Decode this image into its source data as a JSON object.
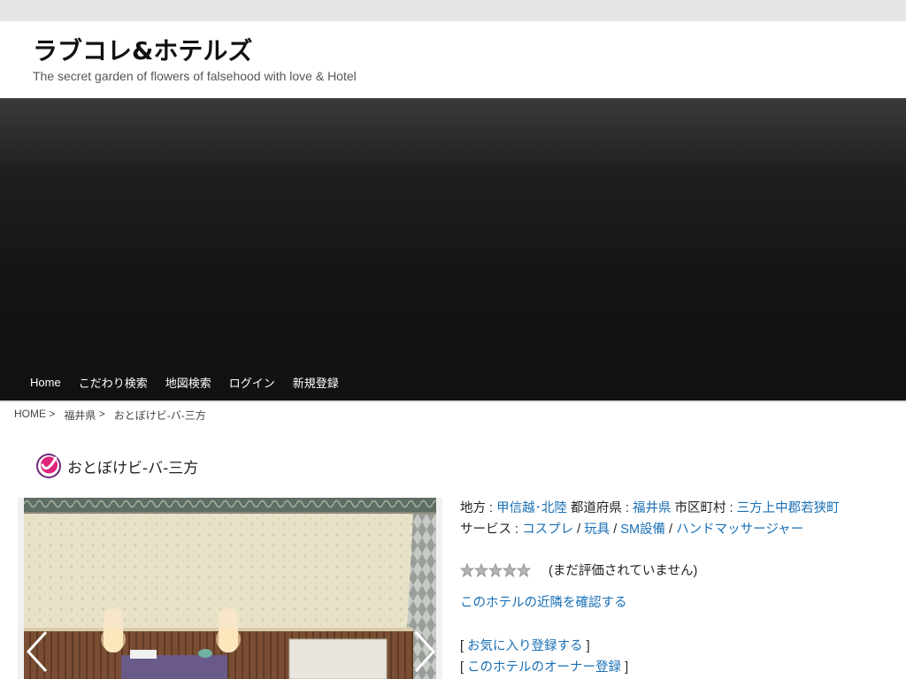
{
  "site": {
    "title": "ラブコレ&ホテルズ",
    "tagline": "The secret garden of flowers of falsehood with love & Hotel"
  },
  "nav": {
    "items": [
      "Home",
      "こだわり検索",
      "地図検索",
      "ログイン",
      "新規登録"
    ]
  },
  "breadcrumb": {
    "home": "HOME",
    "pref": "福井県",
    "current": "おとぼけビ-バ-三方",
    "sep": " > "
  },
  "hotel": {
    "title": "おとぼけビ-バ-三方",
    "region_label": "地方 : ",
    "region": "甲信越･北陸",
    "pref_label": "都道府県 : ",
    "pref": "福井県",
    "city_label": "市区町村 : ",
    "city": "三方上中郡若狭町",
    "service_label": "サービス : ",
    "services": [
      "コスプレ",
      "玩具",
      "SM設備",
      "ハンドマッサージャー"
    ],
    "service_sep": " / "
  },
  "rating": {
    "value": 0,
    "max": 5,
    "text": "(まだ評価されていません)"
  },
  "links": {
    "nearby": "このホテルの近隣を確認する",
    "favorite": "お気に入り登録する",
    "owner": "このホテルのオーナー登録",
    "bracket_open": "[ ",
    "bracket_close": " ]"
  },
  "icons": {
    "title_icon": "hotel-mark-icon",
    "prev": "chevron-left-icon",
    "next": "chevron-right-icon",
    "star": "star-icon"
  },
  "colors": {
    "link": "#1a6fb5",
    "hero": "#141414",
    "topbar": "#e6e6e6"
  }
}
